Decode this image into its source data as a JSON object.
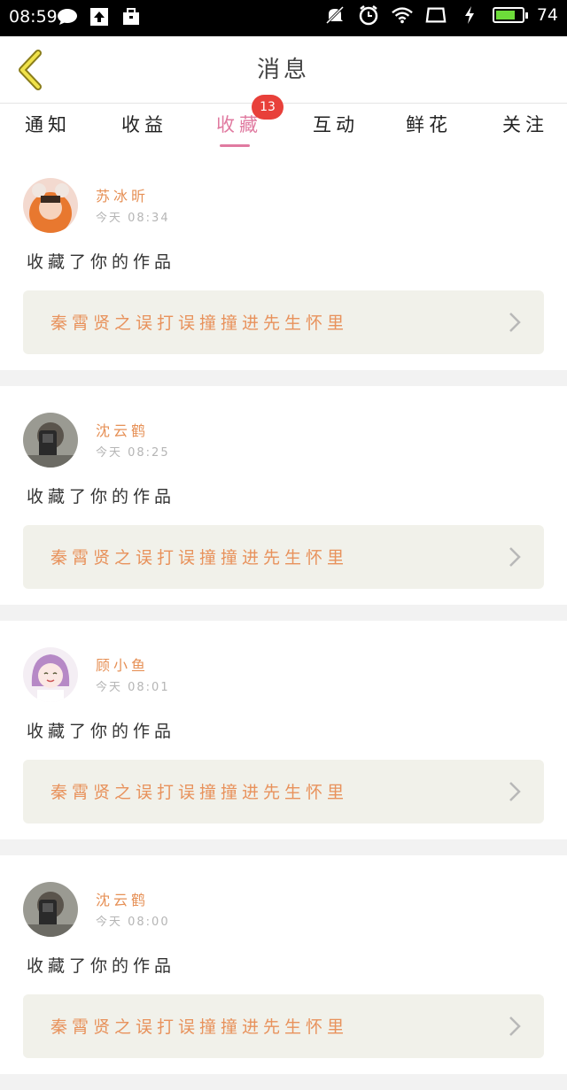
{
  "status_bar": {
    "time": "08:59",
    "battery_level": "74",
    "battery_fraction": 0.74,
    "battery_color": "#6ddc3a"
  },
  "header": {
    "back_icon": "chevron-left-icon",
    "title": "消息"
  },
  "tabs": {
    "items": [
      {
        "label": "通知"
      },
      {
        "label": "收益"
      },
      {
        "label": "收藏"
      },
      {
        "label": "互动"
      },
      {
        "label": "鲜花"
      },
      {
        "label": "关注"
      }
    ],
    "active_index": 2,
    "active_color": "#e07aa0",
    "badge_count": "13",
    "badge_color": "#e8403a"
  },
  "feed": [
    {
      "username": "苏冰昕",
      "time": "今天 08:34",
      "action": "收藏了你的作品",
      "work_title": "秦霄贤之误打误撞撞进先生怀里",
      "avatar": "avatar-orange-costume"
    },
    {
      "username": "沈云鹤",
      "time": "今天 08:25",
      "action": "收藏了你的作品",
      "work_title": "秦霄贤之误打误撞撞进先生怀里",
      "avatar": "avatar-phone-selfie"
    },
    {
      "username": "顾小鱼",
      "time": "今天 08:01",
      "action": "收藏了你的作品",
      "work_title": "秦霄贤之误打误撞撞进先生怀里",
      "avatar": "avatar-anime-girl"
    },
    {
      "username": "沈云鹤",
      "time": "今天 08:00",
      "action": "收藏了你的作品",
      "work_title": "秦霄贤之误打误撞撞进先生怀里",
      "avatar": "avatar-phone-selfie"
    }
  ],
  "colors": {
    "username": "#e69056",
    "work_title": "#e8925c",
    "work_box_bg": "#f1f1ea",
    "divider": "#f2f2f2"
  }
}
